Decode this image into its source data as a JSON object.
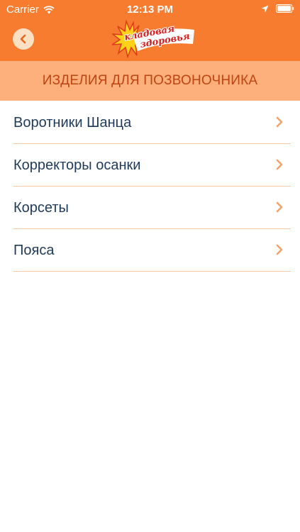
{
  "status_bar": {
    "carrier": "Carrier",
    "time": "12:13 PM",
    "icons": [
      "wifi-icon",
      "location-arrow-icon",
      "battery-icon"
    ]
  },
  "nav": {
    "back_icon": "chevron-left-icon",
    "logo": {
      "line1": "кладовая",
      "line2": "здоровья"
    }
  },
  "section": {
    "title": "ИЗДЕЛИЯ ДЛЯ ПОЗВОНОЧНИКА"
  },
  "list": {
    "items": [
      {
        "label": "Воротники Шанца",
        "icon": "chevron-right-icon"
      },
      {
        "label": "Корректоры осанки",
        "icon": "chevron-right-icon"
      },
      {
        "label": "Корсеты",
        "icon": "chevron-right-icon"
      },
      {
        "label": "Пояса",
        "icon": "chevron-right-icon"
      }
    ]
  },
  "colors": {
    "nav_background": "#f77c2f",
    "header_background": "#fdb07c",
    "header_text": "#c0440f",
    "item_text": "#1f3a5a",
    "chevron": "#f4a36a",
    "divider": "#f6c8a4",
    "logo_text": "#d81e1e",
    "logo_burst": "#ffd21a"
  }
}
